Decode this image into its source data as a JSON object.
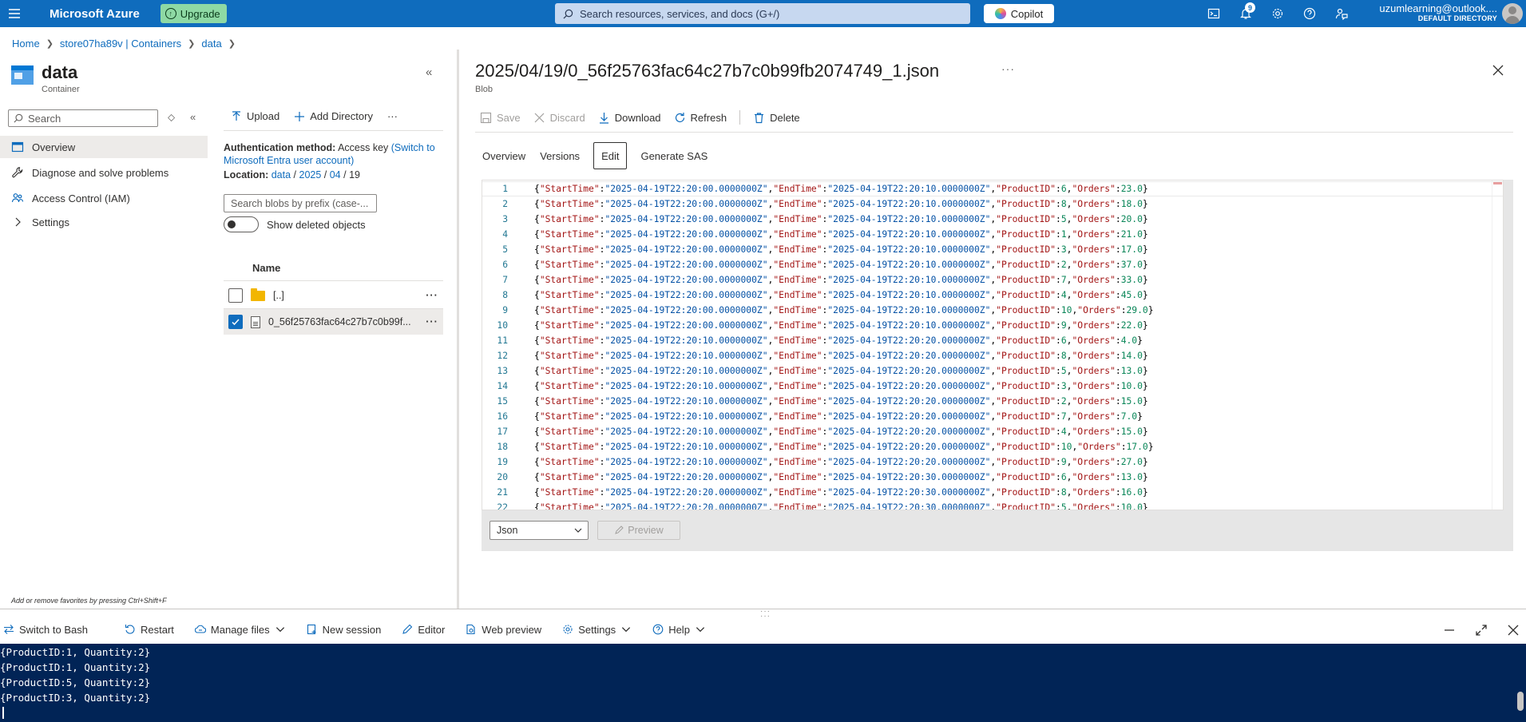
{
  "topbar": {
    "brand": "Microsoft Azure",
    "upgrade_label": "Upgrade",
    "search_placeholder": "Search resources, services, and docs (G+/)",
    "copilot_label": "Copilot",
    "notification_count": "9",
    "account_email": "uzumlearning@outlook....",
    "account_directory": "DEFAULT DIRECTORY"
  },
  "breadcrumb": [
    "Home",
    "store07ha89v | Containers",
    "data"
  ],
  "resource": {
    "title": "data",
    "subtitle": "Container"
  },
  "menu": {
    "search_placeholder": "Search",
    "items": [
      {
        "label": "Overview",
        "icon": "overview-icon",
        "active": true
      },
      {
        "label": "Diagnose and solve problems",
        "icon": "wrench-icon"
      },
      {
        "label": "Access Control (IAM)",
        "icon": "people-icon"
      },
      {
        "label": "Settings",
        "icon": "chevron-right-icon"
      }
    ],
    "fav_hint": "Add or remove favorites by pressing Ctrl+Shift+F"
  },
  "blobs": {
    "toolbar": {
      "upload": "Upload",
      "add_directory": "Add Directory",
      "more": "···"
    },
    "auth_label": "Authentication method:",
    "auth_value": "Access key",
    "auth_link": "(Switch to Microsoft Entra user account)",
    "location_label": "Location:",
    "location_parts": [
      "data",
      "2025",
      "04",
      "19"
    ],
    "search_placeholder": "Search blobs by prefix (case-...",
    "show_deleted": "Show deleted objects",
    "column_name": "Name",
    "rows": [
      {
        "name": "[..]",
        "type": "folder",
        "checked": false
      },
      {
        "name": "0_56f25763fac64c27b7c0b99f...",
        "type": "file",
        "checked": true
      }
    ]
  },
  "blob_view": {
    "title": "2025/04/19/0_56f25763fac64c27b7c0b99fb2074749_1.json",
    "type_label": "Blob",
    "toolbar": {
      "save": "Save",
      "discard": "Discard",
      "download": "Download",
      "refresh": "Refresh",
      "delete": "Delete"
    },
    "tabs": [
      "Overview",
      "Versions",
      "Edit",
      "Generate SAS"
    ],
    "active_tab": "Edit",
    "language": "Json",
    "preview_label": "Preview",
    "lines": [
      {
        "n": "1",
        "start": "2025-04-19T22:20:00.0000000Z",
        "end": "2025-04-19T22:20:10.0000000Z",
        "pid": "6",
        "orders": "23.0"
      },
      {
        "n": "2",
        "start": "2025-04-19T22:20:00.0000000Z",
        "end": "2025-04-19T22:20:10.0000000Z",
        "pid": "8",
        "orders": "18.0"
      },
      {
        "n": "3",
        "start": "2025-04-19T22:20:00.0000000Z",
        "end": "2025-04-19T22:20:10.0000000Z",
        "pid": "5",
        "orders": "20.0"
      },
      {
        "n": "4",
        "start": "2025-04-19T22:20:00.0000000Z",
        "end": "2025-04-19T22:20:10.0000000Z",
        "pid": "1",
        "orders": "21.0"
      },
      {
        "n": "5",
        "start": "2025-04-19T22:20:00.0000000Z",
        "end": "2025-04-19T22:20:10.0000000Z",
        "pid": "3",
        "orders": "17.0"
      },
      {
        "n": "6",
        "start": "2025-04-19T22:20:00.0000000Z",
        "end": "2025-04-19T22:20:10.0000000Z",
        "pid": "2",
        "orders": "37.0"
      },
      {
        "n": "7",
        "start": "2025-04-19T22:20:00.0000000Z",
        "end": "2025-04-19T22:20:10.0000000Z",
        "pid": "7",
        "orders": "33.0"
      },
      {
        "n": "8",
        "start": "2025-04-19T22:20:00.0000000Z",
        "end": "2025-04-19T22:20:10.0000000Z",
        "pid": "4",
        "orders": "45.0"
      },
      {
        "n": "9",
        "start": "2025-04-19T22:20:00.0000000Z",
        "end": "2025-04-19T22:20:10.0000000Z",
        "pid": "10",
        "orders": "29.0"
      },
      {
        "n": "10",
        "start": "2025-04-19T22:20:00.0000000Z",
        "end": "2025-04-19T22:20:10.0000000Z",
        "pid": "9",
        "orders": "22.0"
      },
      {
        "n": "11",
        "start": "2025-04-19T22:20:10.0000000Z",
        "end": "2025-04-19T22:20:20.0000000Z",
        "pid": "6",
        "orders": "4.0"
      },
      {
        "n": "12",
        "start": "2025-04-19T22:20:10.0000000Z",
        "end": "2025-04-19T22:20:20.0000000Z",
        "pid": "8",
        "orders": "14.0"
      },
      {
        "n": "13",
        "start": "2025-04-19T22:20:10.0000000Z",
        "end": "2025-04-19T22:20:20.0000000Z",
        "pid": "5",
        "orders": "13.0"
      },
      {
        "n": "14",
        "start": "2025-04-19T22:20:10.0000000Z",
        "end": "2025-04-19T22:20:20.0000000Z",
        "pid": "3",
        "orders": "10.0"
      },
      {
        "n": "15",
        "start": "2025-04-19T22:20:10.0000000Z",
        "end": "2025-04-19T22:20:20.0000000Z",
        "pid": "2",
        "orders": "15.0"
      },
      {
        "n": "16",
        "start": "2025-04-19T22:20:10.0000000Z",
        "end": "2025-04-19T22:20:20.0000000Z",
        "pid": "7",
        "orders": "7.0"
      },
      {
        "n": "17",
        "start": "2025-04-19T22:20:10.0000000Z",
        "end": "2025-04-19T22:20:20.0000000Z",
        "pid": "4",
        "orders": "15.0"
      },
      {
        "n": "18",
        "start": "2025-04-19T22:20:10.0000000Z",
        "end": "2025-04-19T22:20:20.0000000Z",
        "pid": "10",
        "orders": "17.0"
      },
      {
        "n": "19",
        "start": "2025-04-19T22:20:10.0000000Z",
        "end": "2025-04-19T22:20:20.0000000Z",
        "pid": "9",
        "orders": "27.0"
      },
      {
        "n": "20",
        "start": "2025-04-19T22:20:20.0000000Z",
        "end": "2025-04-19T22:20:30.0000000Z",
        "pid": "6",
        "orders": "13.0"
      },
      {
        "n": "21",
        "start": "2025-04-19T22:20:20.0000000Z",
        "end": "2025-04-19T22:20:30.0000000Z",
        "pid": "8",
        "orders": "16.0"
      },
      {
        "n": "22",
        "start": "2025-04-19T22:20:20.0000000Z",
        "end": "2025-04-19T22:20:30.0000000Z",
        "pid": "5",
        "orders": "10.0"
      }
    ]
  },
  "shell": {
    "toolbar": {
      "switch": "Switch to Bash",
      "restart": "Restart",
      "manage_files": "Manage files",
      "new_session": "New session",
      "editor": "Editor",
      "web_preview": "Web preview",
      "settings": "Settings",
      "help": "Help"
    },
    "output": [
      "{ProductID:1, Quantity:2}",
      "{ProductID:1, Quantity:2}",
      "{ProductID:5, Quantity:2}",
      "{ProductID:3, Quantity:2}"
    ]
  }
}
